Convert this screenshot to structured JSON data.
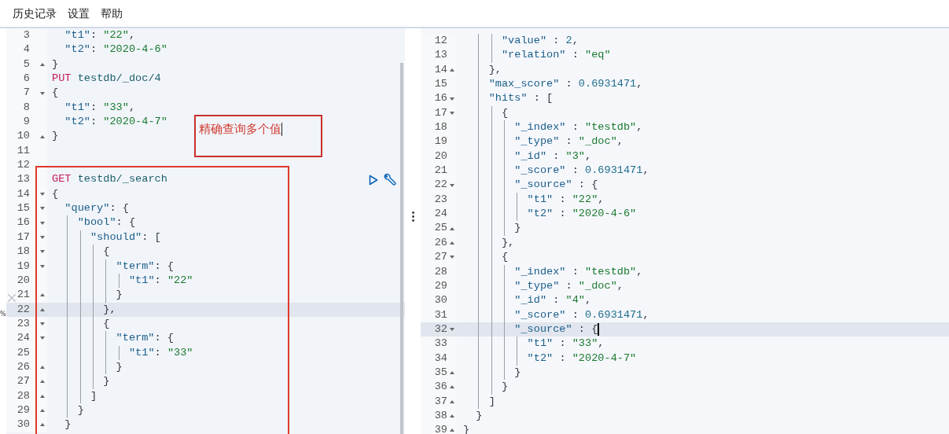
{
  "menu": [
    {
      "label": "历史记录"
    },
    {
      "label": "设置"
    },
    {
      "label": "帮助"
    }
  ],
  "edge_text": "%",
  "left": {
    "lines": [
      {
        "num": "3",
        "kind": "plain",
        "current": false,
        "text": "  \"t1\": \"22\","
      },
      {
        "num": "4",
        "kind": "plain",
        "current": false,
        "text": "  \"t2\": \"2020-4-6\""
      },
      {
        "num": "5",
        "kind": "close",
        "current": false,
        "text": "}"
      },
      {
        "num": "6",
        "kind": "plain",
        "current": false,
        "text": "PUT testdb/_doc/4"
      },
      {
        "num": "7",
        "kind": "open",
        "current": false,
        "text": "{"
      },
      {
        "num": "8",
        "kind": "plain",
        "current": false,
        "text": "  \"t1\": \"33\","
      },
      {
        "num": "9",
        "kind": "plain",
        "current": false,
        "text": "  \"t2\": \"2020-4-7\""
      },
      {
        "num": "10",
        "kind": "close",
        "current": false,
        "text": "}"
      },
      {
        "num": "11",
        "kind": "plain",
        "current": false
      },
      {
        "num": "12",
        "kind": "plain",
        "current": false
      },
      {
        "num": "13",
        "kind": "plain",
        "current": false,
        "text": "GET testdb/_search"
      },
      {
        "num": "14",
        "kind": "open",
        "current": false,
        "text": "{"
      },
      {
        "num": "15",
        "kind": "open",
        "current": false,
        "text": "  \"query\": {"
      },
      {
        "num": "16",
        "kind": "open",
        "current": false,
        "text": "    \"bool\": {"
      },
      {
        "num": "17",
        "kind": "open",
        "current": false,
        "text": "      \"should\": ["
      },
      {
        "num": "18",
        "kind": "open",
        "current": false,
        "text": "        {"
      },
      {
        "num": "19",
        "kind": "open",
        "current": false,
        "text": "          \"term\": {"
      },
      {
        "num": "20",
        "kind": "plain",
        "current": false,
        "text": "            \"t1\": \"22\""
      },
      {
        "num": "21",
        "kind": "close",
        "current": false,
        "text": "          }"
      },
      {
        "num": "22",
        "kind": "close",
        "current": true,
        "text": "        },"
      },
      {
        "num": "23",
        "kind": "open",
        "current": false,
        "text": "        {"
      },
      {
        "num": "24",
        "kind": "open",
        "current": false,
        "text": "          \"term\": {"
      },
      {
        "num": "25",
        "kind": "plain",
        "current": false,
        "text": "            \"t1\": \"33\""
      },
      {
        "num": "26",
        "kind": "close",
        "current": false,
        "text": "          }"
      },
      {
        "num": "27",
        "kind": "close",
        "current": false,
        "text": "        }"
      },
      {
        "num": "28",
        "kind": "close",
        "current": false,
        "text": "      ]"
      },
      {
        "num": "29",
        "kind": "close",
        "current": false,
        "text": "    }"
      },
      {
        "num": "30",
        "kind": "close",
        "current": false,
        "text": "  }"
      }
    ]
  },
  "annotation": {
    "text": "精确查询多个值",
    "cursor": true
  },
  "right": {
    "cursor": true,
    "lines": [
      {
        "num": "12",
        "kind": "plain",
        "current": false,
        "text": "      \"value\" : 2,"
      },
      {
        "num": "13",
        "kind": "plain",
        "current": false,
        "text": "      \"relation\" : \"eq\""
      },
      {
        "num": "14",
        "kind": "close",
        "current": false,
        "text": "    },"
      },
      {
        "num": "15",
        "kind": "plain",
        "current": false,
        "text": "    \"max_score\" : 0.6931471,"
      },
      {
        "num": "16",
        "kind": "open",
        "current": false,
        "text": "    \"hits\" : ["
      },
      {
        "num": "17",
        "kind": "open",
        "current": false,
        "text": "      {"
      },
      {
        "num": "18",
        "kind": "plain",
        "current": false,
        "text": "        \"_index\" : \"testdb\","
      },
      {
        "num": "19",
        "kind": "plain",
        "current": false,
        "text": "        \"_type\" : \"_doc\","
      },
      {
        "num": "20",
        "kind": "plain",
        "current": false,
        "text": "        \"_id\" : \"3\","
      },
      {
        "num": "21",
        "kind": "plain",
        "current": false,
        "text": "        \"_score\" : 0.6931471,"
      },
      {
        "num": "22",
        "kind": "open",
        "current": false,
        "text": "        \"_source\" : {"
      },
      {
        "num": "23",
        "kind": "plain",
        "current": false,
        "text": "          \"t1\" : \"22\","
      },
      {
        "num": "24",
        "kind": "plain",
        "current": false,
        "text": "          \"t2\" : \"2020-4-6\""
      },
      {
        "num": "25",
        "kind": "close",
        "current": false,
        "text": "        }"
      },
      {
        "num": "26",
        "kind": "close",
        "current": false,
        "text": "      },"
      },
      {
        "num": "27",
        "kind": "open",
        "current": false,
        "text": "      {"
      },
      {
        "num": "28",
        "kind": "plain",
        "current": false,
        "text": "        \"_index\" : \"testdb\","
      },
      {
        "num": "29",
        "kind": "plain",
        "current": false,
        "text": "        \"_type\" : \"_doc\","
      },
      {
        "num": "30",
        "kind": "plain",
        "current": false,
        "text": "        \"_id\" : \"4\","
      },
      {
        "num": "31",
        "kind": "plain",
        "current": false,
        "text": "        \"_score\" : 0.6931471,"
      },
      {
        "num": "32",
        "kind": "open",
        "current": true,
        "text": "        \"_source\" : {"
      },
      {
        "num": "33",
        "kind": "plain",
        "current": false,
        "text": "          \"t1\" : \"33\","
      },
      {
        "num": "34",
        "kind": "plain",
        "current": false,
        "text": "          \"t2\" : \"2020-4-7\""
      },
      {
        "num": "35",
        "kind": "close",
        "current": false,
        "text": "        }"
      },
      {
        "num": "36",
        "kind": "close",
        "current": false,
        "text": "      }"
      },
      {
        "num": "37",
        "kind": "close",
        "current": false,
        "text": "    ]"
      },
      {
        "num": "38",
        "kind": "close",
        "current": false,
        "text": "  }"
      },
      {
        "num": "39",
        "kind": "close",
        "current": false,
        "text": "}"
      }
    ]
  }
}
